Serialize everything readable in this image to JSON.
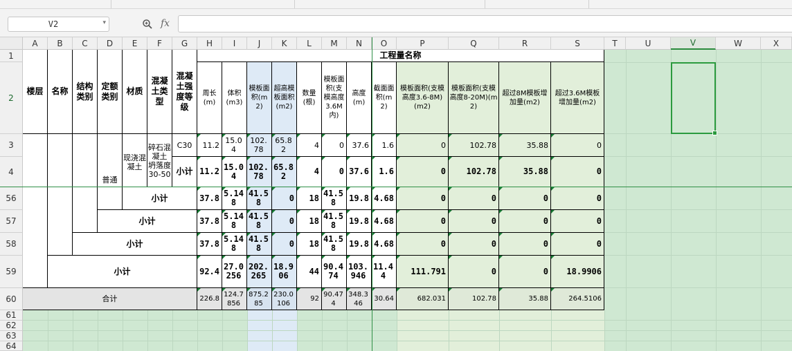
{
  "formula_bar": {
    "name_box": "V2",
    "fx_label": "fx",
    "zoom_icon": "zoom-icon",
    "dropdown_icon": "chevron-down-icon",
    "formula": ""
  },
  "columns": [
    "A",
    "B",
    "C",
    "D",
    "E",
    "F",
    "G",
    "H",
    "I",
    "J",
    "K",
    "L",
    "M",
    "N",
    "O",
    "P",
    "Q",
    "R",
    "S",
    "T",
    "U",
    "V",
    "W",
    "X"
  ],
  "rows": [
    "1",
    "2",
    "3",
    "4",
    "56",
    "57",
    "58",
    "59",
    "60",
    "61",
    "62",
    "63",
    "64"
  ],
  "headers": {
    "title": "工程量名称",
    "a": "楼层",
    "b": "名称",
    "c": "结构类别",
    "d": "定额类别",
    "e": "材质",
    "f": "混凝土类型",
    "g": "混凝土强度等级",
    "h": "周长(m)",
    "i": "体积(m3)",
    "j": "模板面积(m2)",
    "k": "超高模板面积(m2)",
    "l": "数量(根)",
    "m": "模板面积(支模高度3.6M内)",
    "n": "高度(m)",
    "o": "截面面积(m2)",
    "p": "模板面积(支模高度3.6-8M)(m2)",
    "q": "模板面积(支模高度8-20M)(m2)",
    "r": "超过8M模板增加量(m2)",
    "s": "超过3.6M模板增加量(m2)"
  },
  "merged": {
    "d": "普通",
    "e": "现浇混凝土",
    "f": "碎石混凝土 坍落度30-50"
  },
  "row3": {
    "g": "C30",
    "h": "11.2",
    "i": "15.04",
    "j": "102.78",
    "k": "65.82",
    "l": "4",
    "m": "0",
    "n": "37.6",
    "o": "1.6",
    "p": "0",
    "q": "102.78",
    "r": "35.88",
    "s": "0"
  },
  "row4": {
    "g": "小计",
    "h": "11.2",
    "i": "15.04",
    "j": "102.78",
    "k": "65.82",
    "l": "4",
    "m": "0",
    "n": "37.6",
    "o": "1.6",
    "p": "0",
    "q": "102.78",
    "r": "35.88",
    "s": "0"
  },
  "row56": {
    "label": "小计",
    "h": "37.8",
    "i": "5.148",
    "j": "41.58",
    "k": "0",
    "l": "18",
    "m": "41.58",
    "n": "19.8",
    "o": "4.68",
    "p": "0",
    "q": "0",
    "r": "0",
    "s": "0"
  },
  "row57": {
    "label": "小计",
    "h": "37.8",
    "i": "5.148",
    "j": "41.58",
    "k": "0",
    "l": "18",
    "m": "41.58",
    "n": "19.8",
    "o": "4.68",
    "p": "0",
    "q": "0",
    "r": "0",
    "s": "0"
  },
  "row58": {
    "label": "小计",
    "h": "37.8",
    "i": "5.148",
    "j": "41.58",
    "k": "0",
    "l": "18",
    "m": "41.58",
    "n": "19.8",
    "o": "4.68",
    "p": "0",
    "q": "0",
    "r": "0",
    "s": "0"
  },
  "row59": {
    "label": "小计",
    "h": "92.4",
    "i": "27.0256",
    "j": "202.265",
    "k": "18.906",
    "l": "44",
    "m": "90.474",
    "n": "103.946",
    "o": "11.44",
    "p": "111.791",
    "q": "0",
    "r": "0",
    "s": "18.9906"
  },
  "row60": {
    "label": "合计",
    "h": "226.8",
    "i": "124.7856",
    "j": "875.285",
    "k": "230.0106",
    "l": "92",
    "m": "90.474",
    "n": "348.346",
    "o": "30.64",
    "p": "682.031",
    "q": "102.78",
    "r": "35.88",
    "s": "264.5106"
  },
  "colors": {
    "accent_green": "#2b9a3e",
    "header_blue": "#deeaf6",
    "light_green": "#e2efda",
    "selection_green": "#cfe8d2"
  }
}
